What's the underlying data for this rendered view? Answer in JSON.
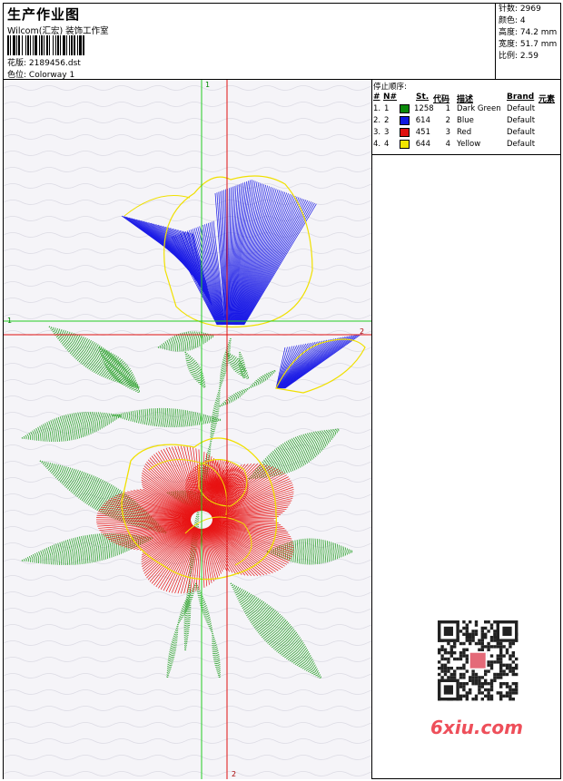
{
  "header": {
    "title": "生产作业图",
    "subtitle": "Wilcom(汇宏) 装饰工作室",
    "design_label": "花版:",
    "design_value": "2189456.dst",
    "colorway_label": "色位:",
    "colorway_value": "Colorway 1"
  },
  "stats": {
    "stitches": "针数: 2969",
    "colors": "颜色: 4",
    "height": "高度: 74.2 mm",
    "width": "宽度: 51.7 mm",
    "ratio": "比例: 2.59"
  },
  "stop_sequence": {
    "title": "停止顺序:",
    "headers": {
      "num": "#",
      "no": "N#",
      "st": "St.",
      "code": "代码",
      "desc": "描述",
      "brand": "Brand",
      "elem": "元素"
    },
    "rows": [
      {
        "num": "1.",
        "no": "1",
        "color": "#0a8a0a",
        "st": "1258",
        "code": "1",
        "desc": "Dark Green",
        "brand": "Default"
      },
      {
        "num": "2.",
        "no": "2",
        "color": "#1018e0",
        "st": "614",
        "code": "2",
        "desc": "Blue",
        "brand": "Default"
      },
      {
        "num": "3.",
        "no": "3",
        "color": "#e01010",
        "st": "451",
        "code": "3",
        "desc": "Red",
        "brand": "Default"
      },
      {
        "num": "4.",
        "no": "4",
        "color": "#f2e600",
        "st": "644",
        "code": "4",
        "desc": "Yellow",
        "brand": "Default"
      }
    ]
  },
  "guides": {
    "vertical_1": "1",
    "horizontal_1": "1",
    "vertical_2": "2",
    "horizontal_2": "2"
  },
  "watermark": "6xiu.com",
  "colors": {
    "green": "#2ea32e",
    "blue": "#1a1ae6",
    "red": "#e81414",
    "yellow": "#f0e000",
    "guide_green": "#22cc22",
    "guide_red": "#e01010"
  }
}
